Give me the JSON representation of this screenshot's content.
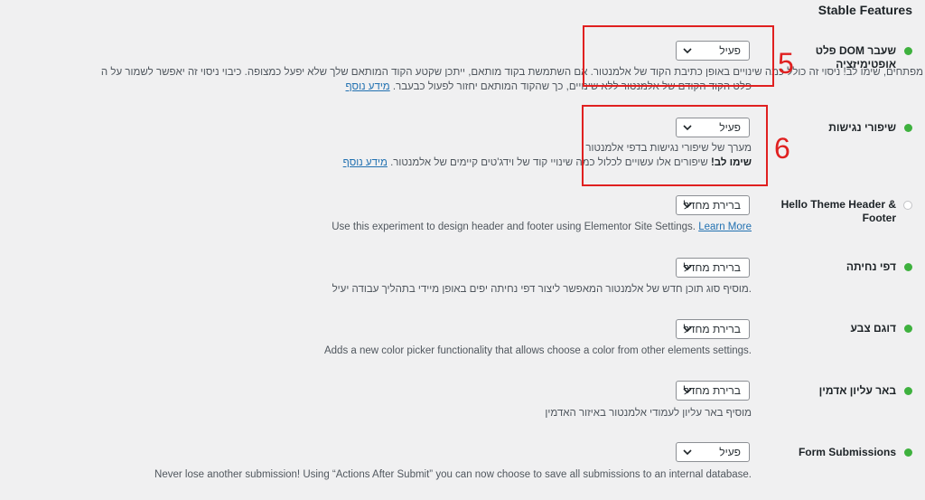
{
  "section_title": "Stable Features",
  "features": [
    {
      "label": "פלט DOM שעבר אופטימיזציה",
      "status": "active",
      "select_value": "פעיל",
      "desc_line1": "מפתחים, שימו לב! ניסוי זה כולל כמה שינויים באופן כתיבת הקוד של אלמנטור. אם השתמשת בקוד מותאם, ייתכן שקטע הקוד המותאם שלך שלא יפעל כמצופה. כיבוי ניסוי זה יאפשר לשמור על ה",
      "desc_line2_text": "פלט הקוד הקודם של אלמנטור ללא שינויים, כך שהקוד המותאם יחזור לפעול כבעבר.",
      "desc_link": "מידע נוסף"
    },
    {
      "label": "שיפורי נגישות",
      "status": "active",
      "select_value": "פעיל",
      "desc_line1": "מערך של שיפורי נגישות בדפי אלמנטור",
      "desc_line2_bold": "שימו לב!",
      "desc_line2_text": "שיפורים אלו עשויים לכלול כמה שינויי קוד של וידג'טים קיימים של אלמנטור.",
      "desc_link": "מידע נוסף"
    },
    {
      "label": "Hello Theme Header & Footer",
      "status": "inactive",
      "select_value": "ברירת מחדל",
      "desc_text": "Use this experiment to design header and footer using Elementor Site Settings.",
      "desc_link": "Learn More"
    },
    {
      "label": "דפי נחיתה",
      "status": "active",
      "select_value": "ברירת מחדל",
      "desc_text": "מוסיף סוג תוכן חדש של אלמנטור המאפשר ליצור דפי נחיתה יפים באופן מיידי בתהליך עבודה יעיל."
    },
    {
      "label": "דוגם צבע",
      "status": "active",
      "select_value": "ברירת מחדל",
      "desc_text": "Adds a new color picker functionality that allows choose a color from other elements settings."
    },
    {
      "label": "באר עליון אדמין",
      "status": "active",
      "select_value": "ברירת מחדל",
      "desc_text": "מוסיף באר עליון לעמודי אלמנטור באיזור האדמין"
    },
    {
      "label": "Form Submissions",
      "status": "active",
      "select_value": "פעיל",
      "desc_text": "Never lose another submission! Using “Actions After Submit” you can now choose to save all submissions to an internal database."
    }
  ],
  "annotations": [
    {
      "number": "5",
      "color": "#e02020"
    },
    {
      "number": "6",
      "color": "#e02020"
    }
  ],
  "colors": {
    "active_dot": "#3eb13e",
    "link": "#2271b1",
    "annotation": "#e02020"
  }
}
